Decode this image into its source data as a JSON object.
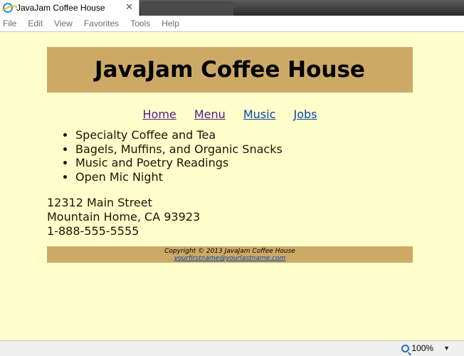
{
  "browser": {
    "tab_title": "JavaJam Coffee House",
    "close_glyph": "✕",
    "menu": [
      "File",
      "Edit",
      "View",
      "Favorites",
      "Tools",
      "Help"
    ],
    "zoom": "100%"
  },
  "page": {
    "header": "JavaJam Coffee House",
    "nav": [
      "Home",
      "Menu",
      "Music",
      "Jobs"
    ],
    "features": [
      "Specialty Coffee and Tea",
      "Bagels, Muffins, and Organic Snacks",
      "Music and Poetry Readings",
      "Open Mic Night"
    ],
    "address": [
      "12312 Main Street",
      "Mountain Home, CA 93923",
      "1-888-555-5555"
    ],
    "footer": {
      "copyright": "Copyright © 2013 JavaJam Coffee House",
      "email": "yourfirstname@yourlastname.com"
    }
  },
  "colors": {
    "page_bg": "#ffffcc",
    "header_bg": "#ccaa66",
    "link": "#0645ad",
    "visited_link": "#551a8b"
  }
}
